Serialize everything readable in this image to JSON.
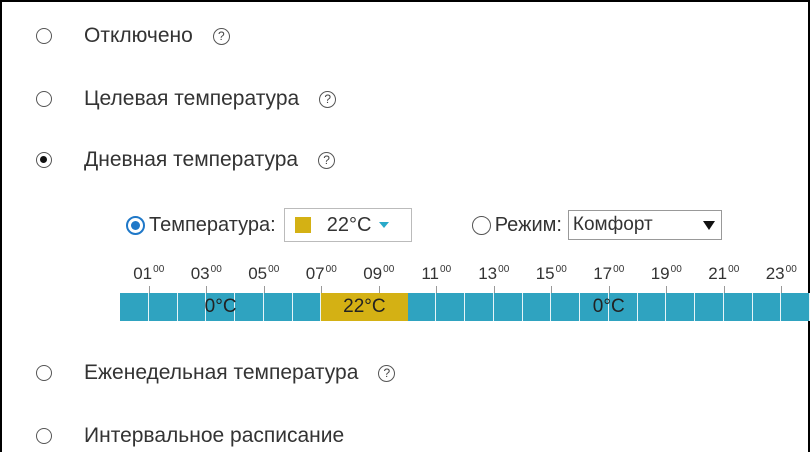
{
  "options": [
    {
      "label": "Отключено",
      "checked": false,
      "help": true
    },
    {
      "label": "Целевая температура",
      "checked": false,
      "help": true
    },
    {
      "label": "Дневная температура",
      "checked": true,
      "help": true
    },
    {
      "label": "Еженедельная температура",
      "checked": false,
      "help": true
    },
    {
      "label": "Интервальное расписание",
      "checked": false,
      "help": false
    }
  ],
  "help_glyph": "?",
  "daily": {
    "temp_radio_label": "Температура:",
    "temp_radio_checked": true,
    "temp_value": "22°C",
    "temp_color": "#d4b114",
    "mode_radio_label": "Режим:",
    "mode_radio_checked": false,
    "mode_value": "Комфорт"
  },
  "timeline": {
    "hours": [
      "01",
      "03",
      "05",
      "07",
      "09",
      "11",
      "13",
      "15",
      "17",
      "19",
      "21",
      "23"
    ],
    "minutes": "00",
    "slot_count": 24,
    "colors": {
      "default": "#2fa3c0",
      "warm": "#d4b114"
    },
    "segments": [
      {
        "from_hour": 0,
        "to_hour": 7,
        "label": "0°C",
        "color": "#2fa3c0"
      },
      {
        "from_hour": 7,
        "to_hour": 10,
        "label": "22°C",
        "color": "#d4b114"
      },
      {
        "from_hour": 10,
        "to_hour": 24,
        "label": "0°C",
        "color": "#2fa3c0"
      }
    ]
  },
  "accent_color": "#1f78c8"
}
